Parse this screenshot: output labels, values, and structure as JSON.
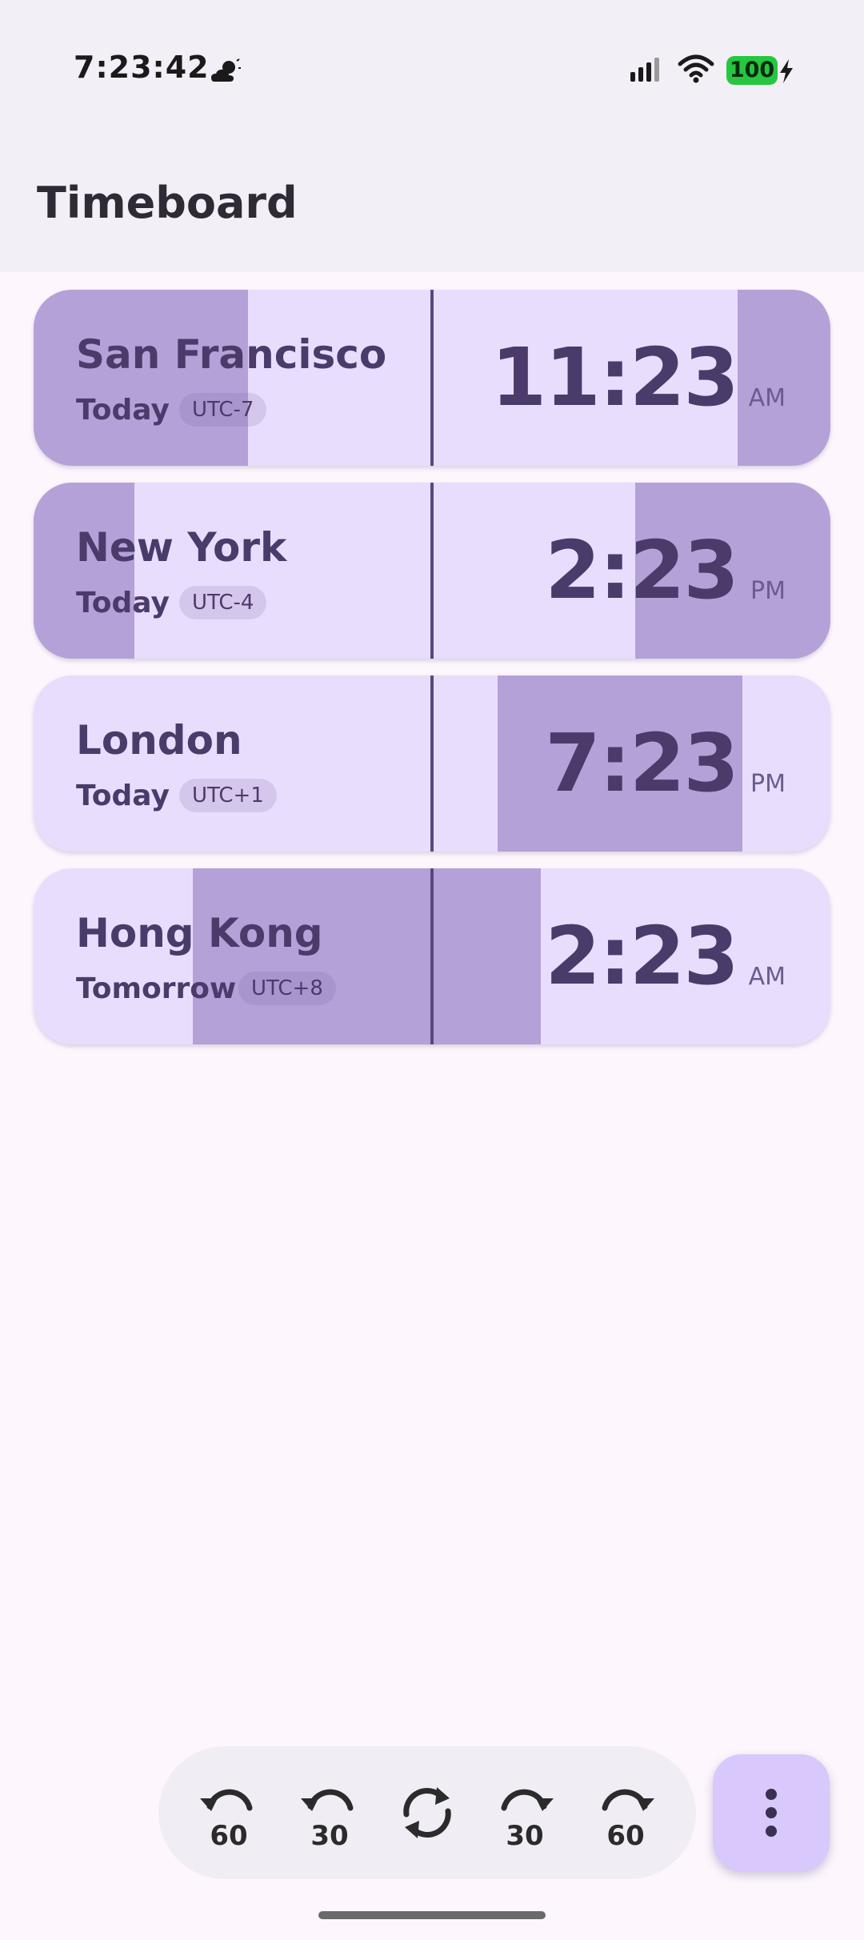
{
  "status_bar": {
    "time": "7:23:42",
    "battery": "100",
    "weather_icon": "partly-cloudy-night-icon",
    "signal_icon": "signal-icon",
    "wifi_icon": "wifi-icon",
    "charging_icon": "bolt-icon"
  },
  "app": {
    "title": "Timeboard"
  },
  "cities": [
    {
      "name": "San Francisco",
      "day": "Today",
      "offset": "UTC-7",
      "time": "11:23",
      "ampm": "AM"
    },
    {
      "name": "New York",
      "day": "Today",
      "offset": "UTC-4",
      "time": "2:23",
      "ampm": "PM"
    },
    {
      "name": "London",
      "day": "Today",
      "offset": "UTC+1",
      "time": "7:23",
      "ampm": "PM"
    },
    {
      "name": "Hong Kong",
      "day": "Tomorrow",
      "offset": "UTC+8",
      "time": "2:23",
      "ampm": "AM"
    }
  ],
  "controls": {
    "back_60": {
      "label": "60",
      "icon": "rewind-icon"
    },
    "back_30": {
      "label": "30",
      "icon": "rewind-icon"
    },
    "reset": {
      "icon": "sync-icon"
    },
    "forward_30": {
      "label": "30",
      "icon": "forward-icon"
    },
    "forward_60": {
      "label": "60",
      "icon": "forward-icon"
    },
    "menu": {
      "icon": "more-vertical-icon"
    }
  },
  "colors": {
    "card_day": "#e9ddfd",
    "card_night": "#b4a1d8",
    "accent_text": "#4a3b6a",
    "menu_button": "#d8c8fb"
  }
}
